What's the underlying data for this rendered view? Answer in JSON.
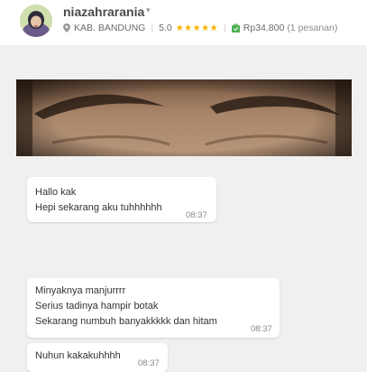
{
  "header": {
    "username": "niazahrarania",
    "caret": "▾",
    "location": "KAB. BANDUNG",
    "rating": "5.0",
    "stars": "★★★★★",
    "price": "Rp34.800",
    "orders": "(1 pesanan)"
  },
  "icons": {
    "avatar": "user-avatar",
    "location": "map-pin-icon",
    "rating": "star-icon",
    "order": "shopping-bag-icon"
  },
  "colors": {
    "stars": "#f5b301",
    "bag_icon": "#4caf50",
    "background": "#f0f0f0"
  },
  "messages": [
    {
      "lines": [
        "Hallo kak",
        "Hepi sekarang aku tuhhhhhh"
      ],
      "time": "08:37"
    },
    {
      "lines": [
        "Minyaknya manjurrrr",
        "Serius tadinya hampir botak",
        "Sekarang numbuh banyakkkkk dan hitam"
      ],
      "time": "08:37"
    },
    {
      "lines": [
        "Nuhun kakakuhhhh"
      ],
      "time": "08:37"
    }
  ]
}
